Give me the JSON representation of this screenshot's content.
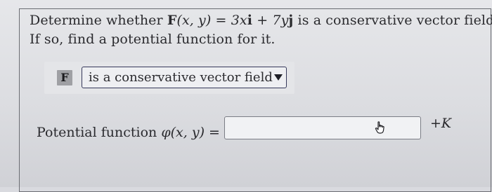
{
  "question": {
    "line1_prefix": "Determine whether ",
    "line1_field_name": "F",
    "line1_field_args": "(x, y)",
    "line1_equals": " = ",
    "line1_term1_coef": "3x",
    "line1_term1_vec": "i",
    "line1_plus": " + ",
    "line1_term2_coef": "7y",
    "line1_term2_vec": "j",
    "line1_suffix": " is a conservative vector field.",
    "line2": "If so, find a potential function for it."
  },
  "conservative_answer": {
    "badge": "F",
    "selected_value": "is a conservative vector field"
  },
  "potential": {
    "label_prefix": "Potential function ",
    "label_symbol": "φ",
    "label_args": "(x, y)",
    "label_equals": " =",
    "input_value": "",
    "constant": "+K"
  },
  "icons": {
    "cursor": "hand-pointer-icon",
    "dropdown": "caret-down-icon"
  },
  "colors": {
    "select_border": "#36395a",
    "card_border": "#6b6d73"
  }
}
